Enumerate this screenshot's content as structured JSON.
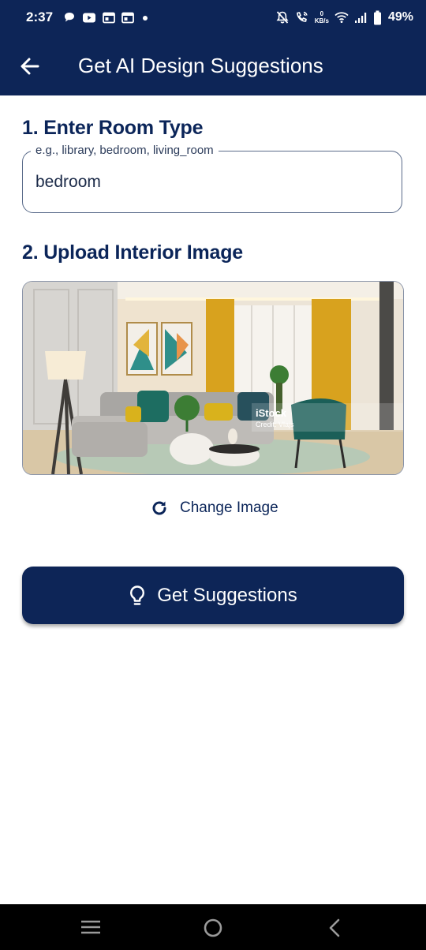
{
  "status_bar": {
    "time": "2:37",
    "network_speed_value": "0",
    "network_speed_unit": "KB/s",
    "battery_percent": "49%"
  },
  "app_bar": {
    "title": "Get AI Design Suggestions"
  },
  "room_type": {
    "heading": "1. Enter Room Type",
    "label": "e.g., library, bedroom, living_room",
    "value": "bedroom"
  },
  "upload": {
    "heading": "2. Upload Interior Image",
    "watermark_brand": "iStock",
    "watermark_credit": "Credit: Vlajs",
    "change_label": "Change Image"
  },
  "action": {
    "label": "Get Suggestions"
  },
  "colors": {
    "primary": "#0d2557",
    "text": "#0b2559"
  }
}
